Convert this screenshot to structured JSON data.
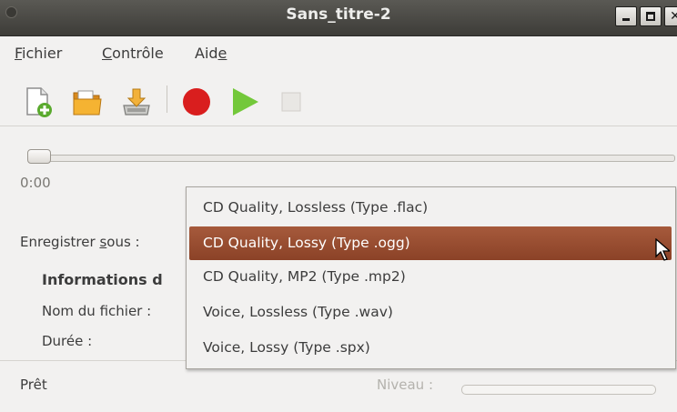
{
  "window": {
    "title": "Sans_titre-2"
  },
  "menu": {
    "items": [
      {
        "label_pre": "",
        "label_ul": "F",
        "label_post": "ichier"
      },
      {
        "label_pre": "",
        "label_ul": "C",
        "label_post": "ontrôle"
      },
      {
        "label_pre": "Aid",
        "label_ul": "e",
        "label_post": ""
      }
    ]
  },
  "toolbar": {
    "icons": [
      "new-file-icon",
      "open-folder-icon",
      "save-icon",
      "record-icon",
      "play-icon",
      "stop-icon"
    ]
  },
  "player": {
    "time": "0:00",
    "position": 0.0
  },
  "form": {
    "save_as_pre": "Enregistrer ",
    "save_as_ul": "s",
    "save_as_post": "ous :",
    "info_heading": "Informations d",
    "filename_label": "Nom du fichier :",
    "duration_label": "Durée :"
  },
  "status": {
    "text": "Prêt",
    "level_label": "Niveau :",
    "level": 0.0
  },
  "dropdown": {
    "selected_index": 1,
    "options": [
      "CD Quality, Lossless (Type .flac)",
      "CD Quality, Lossy (Type .ogg)",
      "CD Quality, MP2 (Type .mp2)",
      "Voice, Lossless (Type .wav)",
      "Voice, Lossy (Type .spx)"
    ]
  },
  "colors": {
    "selection": "#9a4c2f",
    "record": "#d91e1e",
    "play": "#73c83a"
  }
}
